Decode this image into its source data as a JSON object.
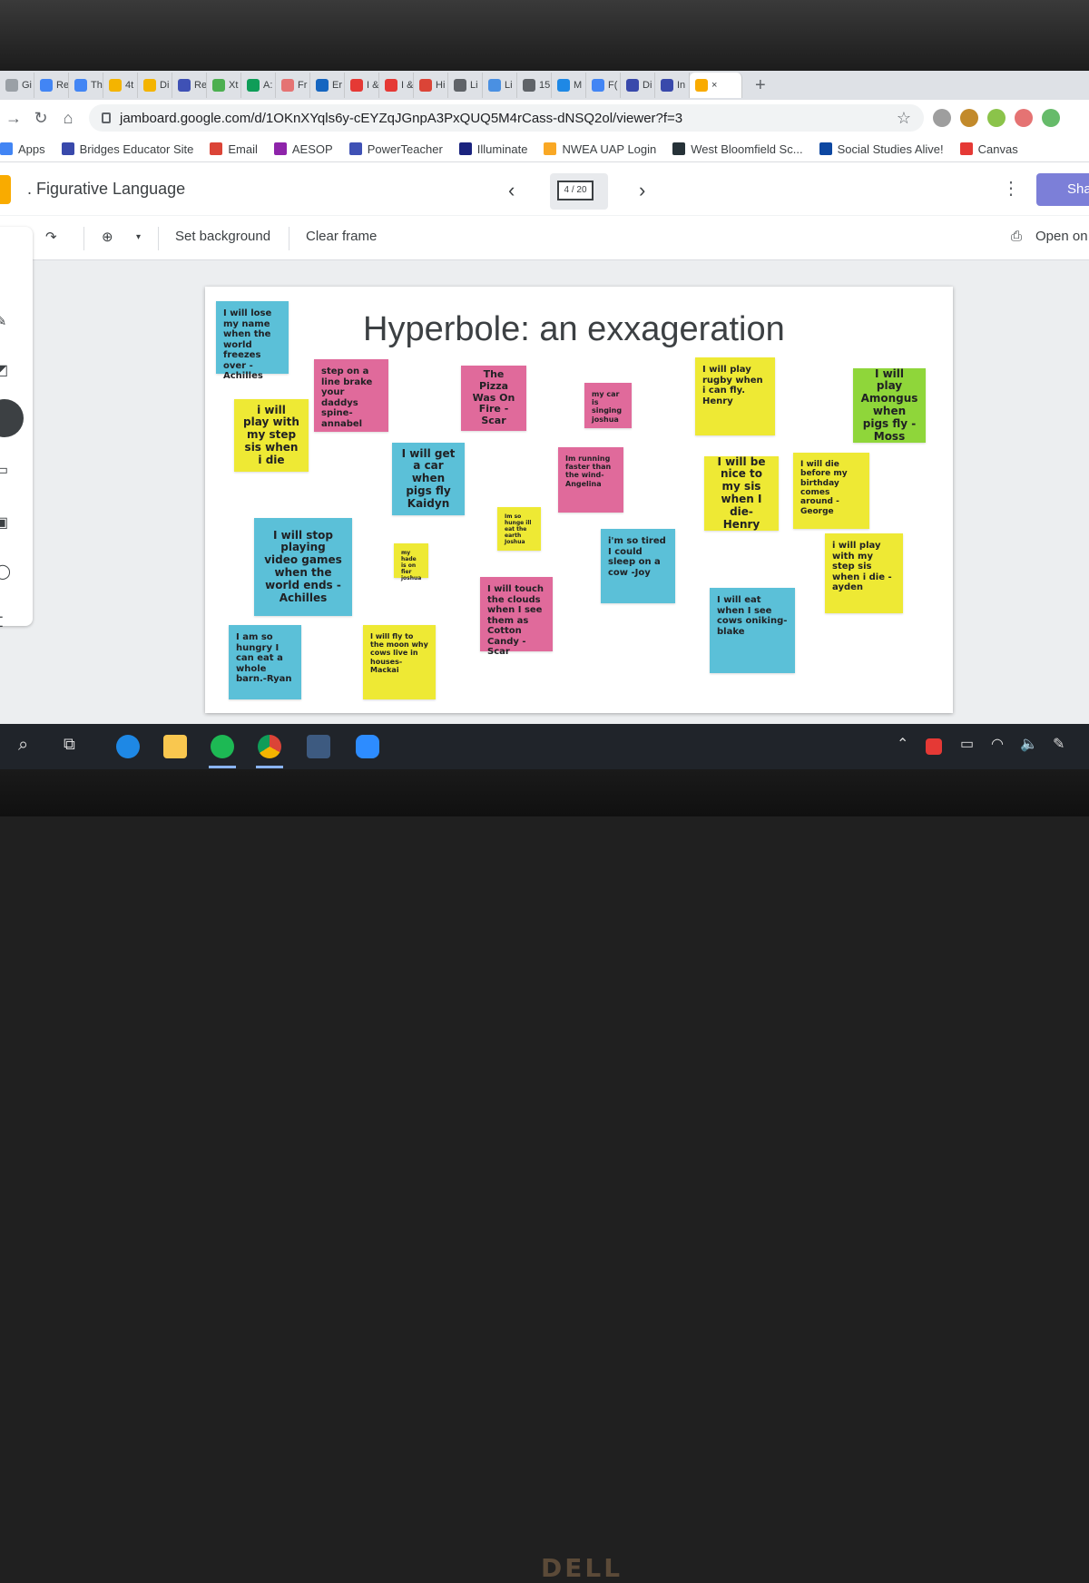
{
  "browser": {
    "tabs": [
      {
        "label": "Gi",
        "color": "#9aa0a6"
      },
      {
        "label": "Re",
        "color": "#4285f4"
      },
      {
        "label": "Th",
        "color": "#4285f4"
      },
      {
        "label": "4t",
        "color": "#f4b400"
      },
      {
        "label": "Di",
        "color": "#f4b400"
      },
      {
        "label": "Re",
        "color": "#3f51b5"
      },
      {
        "label": "Xt",
        "color": "#4caf50"
      },
      {
        "label": "A:",
        "color": "#0f9d58"
      },
      {
        "label": "Fr",
        "color": "#e57373"
      },
      {
        "label": "Er",
        "color": "#1565c0"
      },
      {
        "label": "I &",
        "color": "#e53935"
      },
      {
        "label": "I &",
        "color": "#e53935"
      },
      {
        "label": "Hi",
        "color": "#db4437"
      },
      {
        "label": "Li",
        "color": "#5f6368"
      },
      {
        "label": "Li",
        "color": "#4a90e2"
      },
      {
        "label": "15",
        "color": "#5f6368"
      },
      {
        "label": "M",
        "color": "#1e88e5"
      },
      {
        "label": "F(",
        "color": "#4285f4"
      },
      {
        "label": "Di",
        "color": "#3949ab"
      },
      {
        "label": "In",
        "color": "#3949ab"
      }
    ],
    "active_tab_close": "×",
    "new_tab": "+",
    "url": "jamboard.google.com/d/1OKnXYqls6y-cEYZqJGnpA3PxQUQ5M4rCass-dNSQ2ol/viewer?f=3",
    "bookmarks": [
      {
        "label": "Apps",
        "color": "#4285f4"
      },
      {
        "label": "Bridges Educator Site",
        "color": "#3949ab"
      },
      {
        "label": "Email",
        "color": "#db4437"
      },
      {
        "label": "AESOP",
        "color": "#8e24aa"
      },
      {
        "label": "PowerTeacher",
        "color": "#3f51b5"
      },
      {
        "label": "Illuminate",
        "color": "#1a237e"
      },
      {
        "label": "NWEA UAP Login",
        "color": "#f9a825"
      },
      {
        "label": "West Bloomfield Sc...",
        "color": "#263238"
      },
      {
        "label": "Social Studies Alive!",
        "color": "#0d47a1"
      },
      {
        "label": "Canvas",
        "color": "#e53935"
      }
    ]
  },
  "jamboard": {
    "title": ". Figurative Language",
    "frame_indicator": "4 / 20",
    "share_label": "Sha",
    "toolbar": {
      "set_background": "Set background",
      "clear_frame": "Clear frame",
      "open_on": "Open on"
    },
    "board_title": "Hyperbole: an exxageration",
    "notes": [
      {
        "text": "I will lose my name when the world freezes over  -Achilles",
        "color": "#5bc0d8"
      },
      {
        "text": "step on a line brake your daddys spine-annabel",
        "color": "#e06a9b"
      },
      {
        "text": "The Pizza Was On Fire -Scar",
        "color": "#e06a9b"
      },
      {
        "text": "my car is singing joshua",
        "color": "#e06a9b"
      },
      {
        "text": "I will play rugby when i can fly. Henry",
        "color": "#eee934"
      },
      {
        "text": "I will play Amongus when pigs fly -Moss",
        "color": "#8fd63a"
      },
      {
        "text": "i will play with my step sis when i die",
        "color": "#eee934"
      },
      {
        "text": "I will get a car when pigs fly Kaidyn",
        "color": "#5bc0d8"
      },
      {
        "text": "Im running faster than the wind-Angelina",
        "color": "#e06a9b"
      },
      {
        "text": "I will be nice to my sis when I die-Henry",
        "color": "#eee934"
      },
      {
        "text": "I will die before my birthday comes around -George",
        "color": "#eee934"
      },
      {
        "text": "Im so hunge ill eat the earth Joshua",
        "color": "#eee934"
      },
      {
        "text": "I will stop playing video games when the world ends -Achilles",
        "color": "#5bc0d8"
      },
      {
        "text": "my hade is on fier joshua",
        "color": "#eee934"
      },
      {
        "text": "i'm so tired I could sleep on a cow -Joy",
        "color": "#5bc0d8"
      },
      {
        "text": "i will play with my step sis when i die -ayden",
        "color": "#eee934"
      },
      {
        "text": "I will touch the clouds when I see them as Cotton Candy -Scar",
        "color": "#e06a9b"
      },
      {
        "text": "I will eat when I see cows oniking-blake",
        "color": "#5bc0d8"
      },
      {
        "text": "I am so hungry I can eat a whole barn.-Ryan",
        "color": "#5bc0d8"
      },
      {
        "text": "I will fly to the moon why cows live in houses-Mackai",
        "color": "#eee934"
      }
    ]
  },
  "device": {
    "brand": "DELL"
  }
}
